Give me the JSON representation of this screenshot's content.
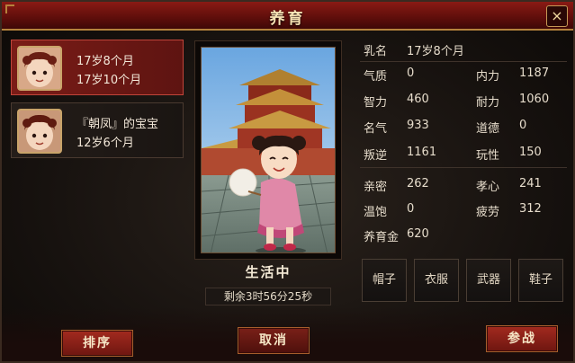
{
  "window": {
    "title": "养育",
    "close_icon": "×"
  },
  "children": [
    {
      "line1": "17岁8个月",
      "line2": "17岁10个月",
      "selected": true
    },
    {
      "line1": "『朝凤』的宝宝",
      "line2": "12岁6个月",
      "selected": false
    }
  ],
  "portrait": {
    "status": "生活中",
    "timer": "剩余3时56分25秒"
  },
  "stats": {
    "nickname_label": "乳名",
    "nickname_value": "17岁8个月",
    "qizhi_label": "气质",
    "qizhi_value": "0",
    "neili_label": "内力",
    "neili_value": "1187",
    "zhili_label": "智力",
    "zhili_value": "460",
    "naili_label": "耐力",
    "naili_value": "1060",
    "mingqi_label": "名气",
    "mingqi_value": "933",
    "daode_label": "道德",
    "daode_value": "0",
    "panni_label": "叛逆",
    "panni_value": "1161",
    "wanxing_label": "玩性",
    "wanxing_value": "150",
    "qinmi_label": "亲密",
    "qinmi_value": "262",
    "xiaoxin_label": "孝心",
    "xiaoxin_value": "241",
    "wenbao_label": "温饱",
    "wenbao_value": "0",
    "pilao_label": "疲劳",
    "pilao_value": "312",
    "yangyujin_label": "养育金",
    "yangyujin_value": "620"
  },
  "equipment": {
    "hat": "帽子",
    "clothes": "衣服",
    "weapon": "武器",
    "shoes": "鞋子"
  },
  "buttons": {
    "sort": "排序",
    "cancel": "取消",
    "battle": "参战"
  }
}
